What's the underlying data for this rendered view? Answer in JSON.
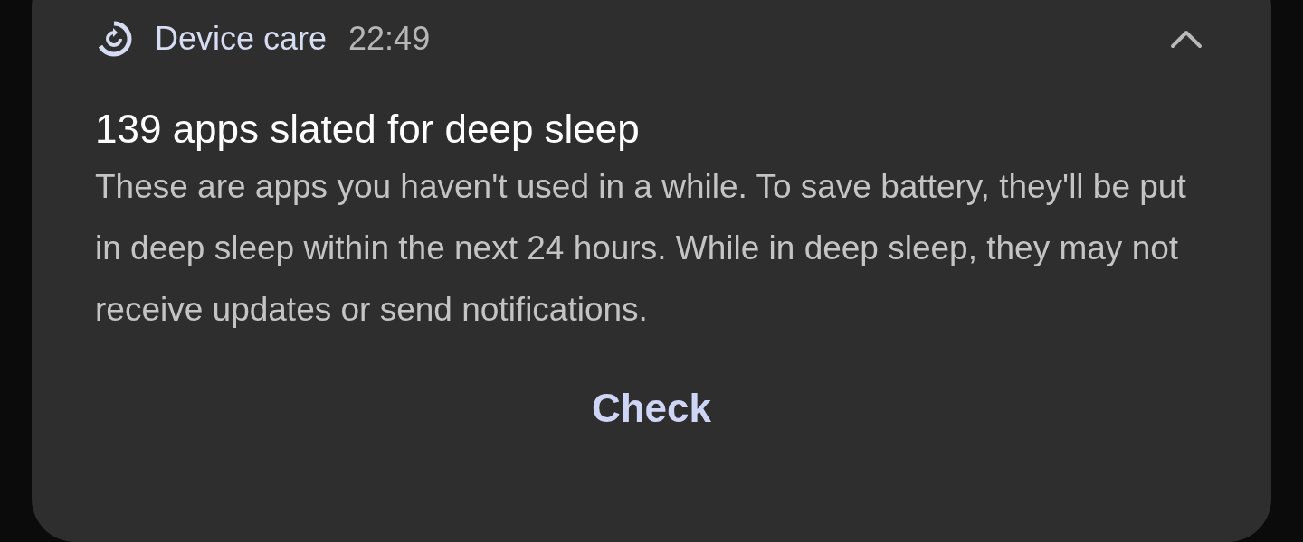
{
  "notification": {
    "app_name": "Device care",
    "time": "22:49",
    "expanded": true,
    "title": "139 apps slated for deep sleep",
    "body": "These are apps you haven't used in a while. To save battery, they'll be put in deep sleep within the next 24 hours. While in deep sleep, they may not receive updates or send notifications.",
    "actions": [
      "Check"
    ]
  }
}
